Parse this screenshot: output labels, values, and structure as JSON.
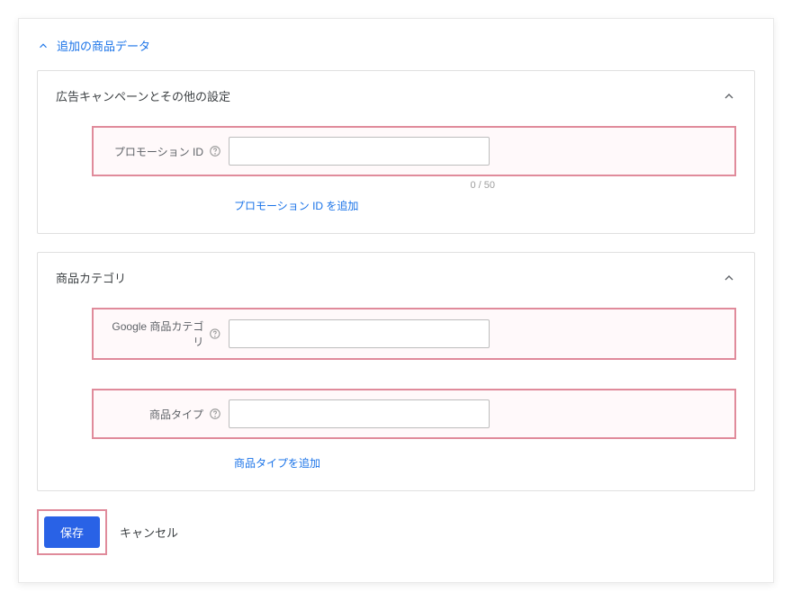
{
  "expand": {
    "label": "追加の商品データ"
  },
  "section_campaign": {
    "title": "広告キャンペーンとその他の設定",
    "promotion_id": {
      "label": "プロモーション ID",
      "value": "",
      "counter": "0 / 50",
      "add_link": "プロモーション ID を追加"
    }
  },
  "section_category": {
    "title": "商品カテゴリ",
    "google_category": {
      "label": "Google 商品カテゴリ",
      "value": ""
    },
    "product_type": {
      "label": "商品タイプ",
      "value": "",
      "add_link": "商品タイプを追加"
    }
  },
  "footer": {
    "save": "保存",
    "cancel": "キャンセル"
  }
}
